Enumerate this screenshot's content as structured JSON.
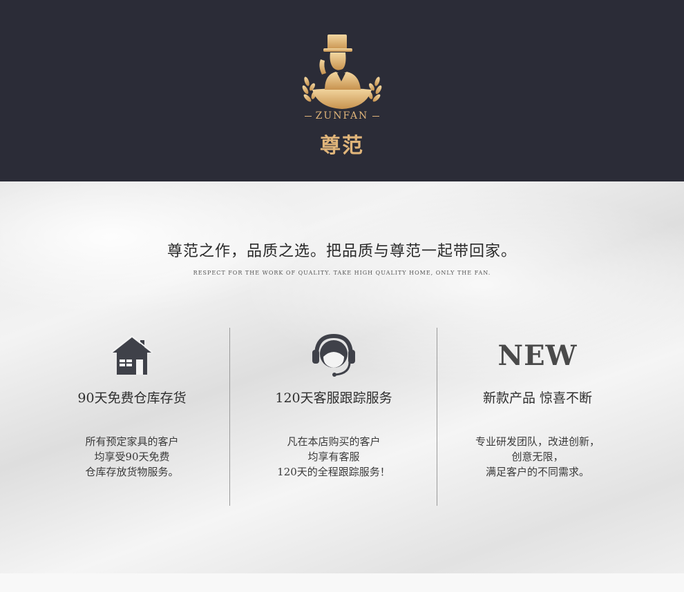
{
  "brand": {
    "en": "ZUNFAN",
    "cn": "尊范",
    "gold": "#e0b57a",
    "bg": "#2b2c37"
  },
  "slogan": {
    "main": "尊范之作，品质之选。把品质与尊范一起带回家。",
    "sub": "RESPECT  FOR  THE  WORK  OF  QUALITY.  TAKE   HIGH  QUALITY   HOME,  ONLY  THE FAN."
  },
  "features": [
    {
      "icon": "house-icon",
      "title": "90天免费仓库存货",
      "desc": [
        "所有预定家具的客户",
        "均享受90天免费",
        "仓库存放货物服务。"
      ]
    },
    {
      "icon": "headset-icon",
      "title": "120天客服跟踪服务",
      "desc": [
        "凡在本店购买的客户",
        "均享有客服",
        "120天的全程跟踪服务！"
      ]
    },
    {
      "icon": "new-icon",
      "icon_text": "NEW",
      "title": "新款产品 惊喜不断",
      "desc": [
        "专业研发团队，改进创新，",
        "创意无限，",
        "满足客户的不同需求。"
      ]
    }
  ]
}
